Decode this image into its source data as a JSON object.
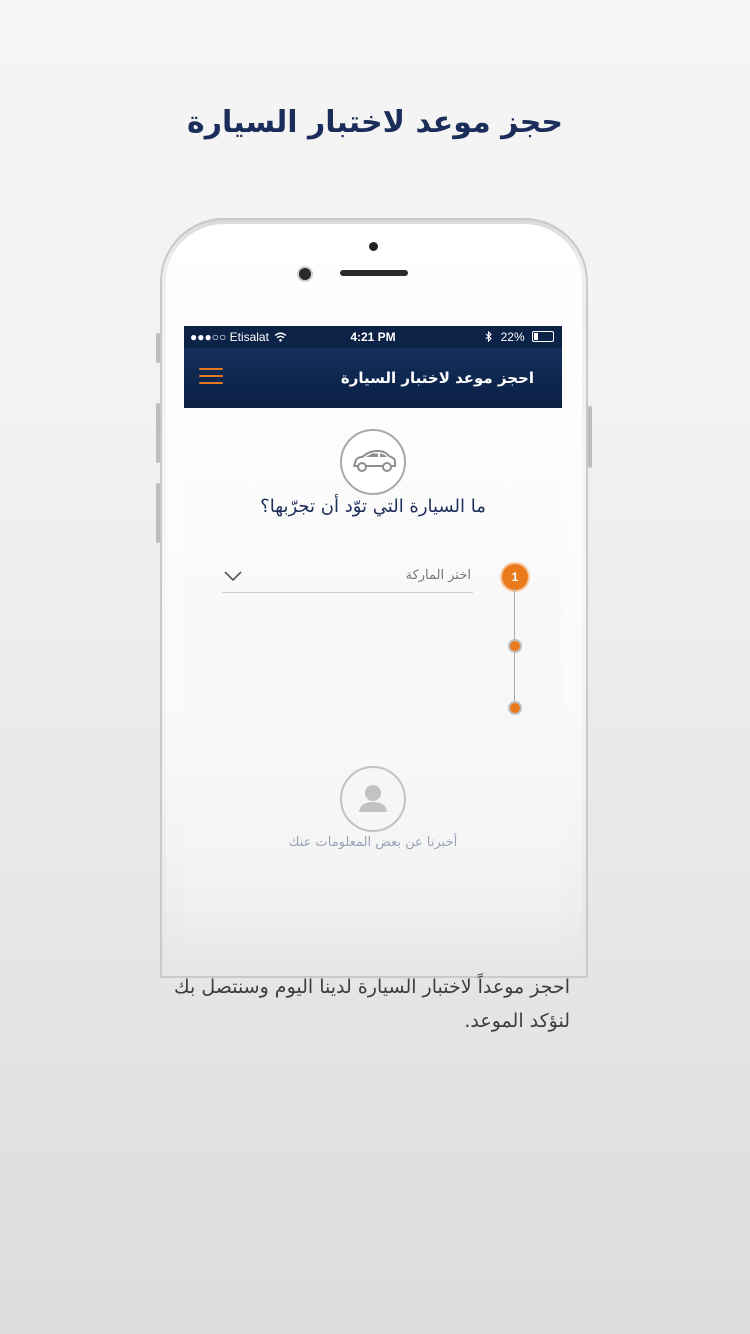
{
  "promo": {
    "title": "حجز موعد لاختبار السيارة",
    "caption": "احجز موعداً لاختبار السيارة لدينا اليوم وسنتصل بك لنؤكد الموعد."
  },
  "status_bar": {
    "carrier": "●●●○○ Etisalat",
    "time": "4:21 PM",
    "battery": "22%"
  },
  "nav": {
    "title": "احجز موعد لاختبار السيارة",
    "menu_icon": "hamburger-menu-icon"
  },
  "step_car": {
    "icon": "car-icon",
    "question": "ما السيارة التي توّد أن تجرّبها؟",
    "step_number": "1",
    "brand_select": {
      "placeholder": "اختر الماركة",
      "icon": "chevron-down-icon"
    }
  },
  "step_user": {
    "icon": "user-icon",
    "label": "أخبرنا عن بعض المعلومات عنك"
  },
  "colors": {
    "navy": "#0d2247",
    "accent": "#ea7a1c",
    "title_text": "#1b2d5a"
  }
}
